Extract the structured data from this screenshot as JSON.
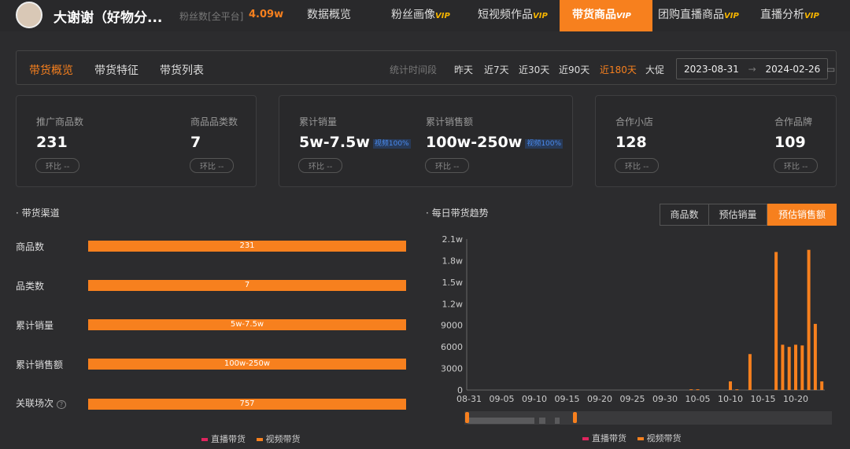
{
  "header": {
    "name": "大谢谢（好物分...",
    "fans_label": "粉丝数[全平台]",
    "fans_value": "4.09w",
    "nav": [
      {
        "label": "数据概览",
        "vip": ""
      },
      {
        "label": "粉丝画像",
        "vip": "VIP"
      },
      {
        "label": "短视频作品",
        "vip": "VIP"
      },
      {
        "label": "带货商品",
        "vip": "VIP"
      },
      {
        "label": "团购直播商品",
        "vip": "VIP"
      },
      {
        "label": "直播分析",
        "vip": "VIP"
      }
    ]
  },
  "subtabs": [
    "带货概览",
    "带货特征",
    "带货列表"
  ],
  "period": {
    "label": "统计时间段",
    "options": [
      "昨天",
      "近7天",
      "近30天",
      "近90天",
      "近180天",
      "大促"
    ],
    "selected": "近180天",
    "start": "2023-08-31",
    "arrow": "→",
    "end": "2024-02-26"
  },
  "kpis": [
    {
      "label": "推广商品数",
      "value": "231",
      "tag": "",
      "compare": "环比 --"
    },
    {
      "label": "商品品类数",
      "value": "7",
      "tag": "",
      "compare": "环比 --"
    },
    {
      "label": "累计销量",
      "value": "5w-7.5w",
      "tag": "视频100%",
      "compare": "环比 --"
    },
    {
      "label": "累计销售额",
      "value": "100w-250w",
      "tag": "视频100%",
      "compare": "环比 --"
    },
    {
      "label": "合作小店",
      "value": "128",
      "tag": "",
      "compare": "环比 --"
    },
    {
      "label": "合作品牌",
      "value": "109",
      "tag": "",
      "compare": "环比 --"
    }
  ],
  "channel": {
    "title": "· 带货渠道",
    "rows": [
      {
        "label": "商品数",
        "value": "231"
      },
      {
        "label": "品类数",
        "value": "7"
      },
      {
        "label": "累计销量",
        "value": "5w-7.5w"
      },
      {
        "label": "累计销售额",
        "value": "100w-250w"
      },
      {
        "label": "关联场次",
        "value": "757"
      }
    ],
    "legend": [
      "直播带货",
      "视频带货"
    ]
  },
  "trend": {
    "title": "· 每日带货趋势",
    "toggles": [
      "商品数",
      "预估销量",
      "预估销售额"
    ],
    "selected": "预估销售额"
  },
  "colors": {
    "accent": "#f7801e",
    "live": "#e0245e",
    "video": "#f7801e"
  },
  "chart_data": {
    "type": "bar",
    "title": "每日带货趋势",
    "ylim": [
      0,
      21000
    ],
    "yticks": [
      "0",
      "3000",
      "6000",
      "9000",
      "1.2w",
      "1.5w",
      "1.8w",
      "2.1w"
    ],
    "xticks": [
      "08-31",
      "09-05",
      "09-10",
      "09-15",
      "09-20",
      "09-25",
      "09-30",
      "10-05",
      "10-10",
      "10-15",
      "10-20"
    ],
    "series": [
      {
        "name": "视频带货",
        "points": [
          [
            "10-04",
            100
          ],
          [
            "10-05",
            100
          ],
          [
            "10-10",
            1200
          ],
          [
            "10-11",
            100
          ],
          [
            "10-13",
            5000
          ],
          [
            "10-17",
            19200
          ],
          [
            "10-18",
            6300
          ],
          [
            "10-19",
            6000
          ],
          [
            "10-20",
            6300
          ],
          [
            "10-21",
            6200
          ],
          [
            "10-22",
            19500
          ],
          [
            "10-23",
            9200
          ],
          [
            "10-24",
            1200
          ]
        ]
      },
      {
        "name": "直播带货",
        "points": []
      }
    ],
    "legend": [
      "直播带货",
      "视频带货"
    ]
  }
}
